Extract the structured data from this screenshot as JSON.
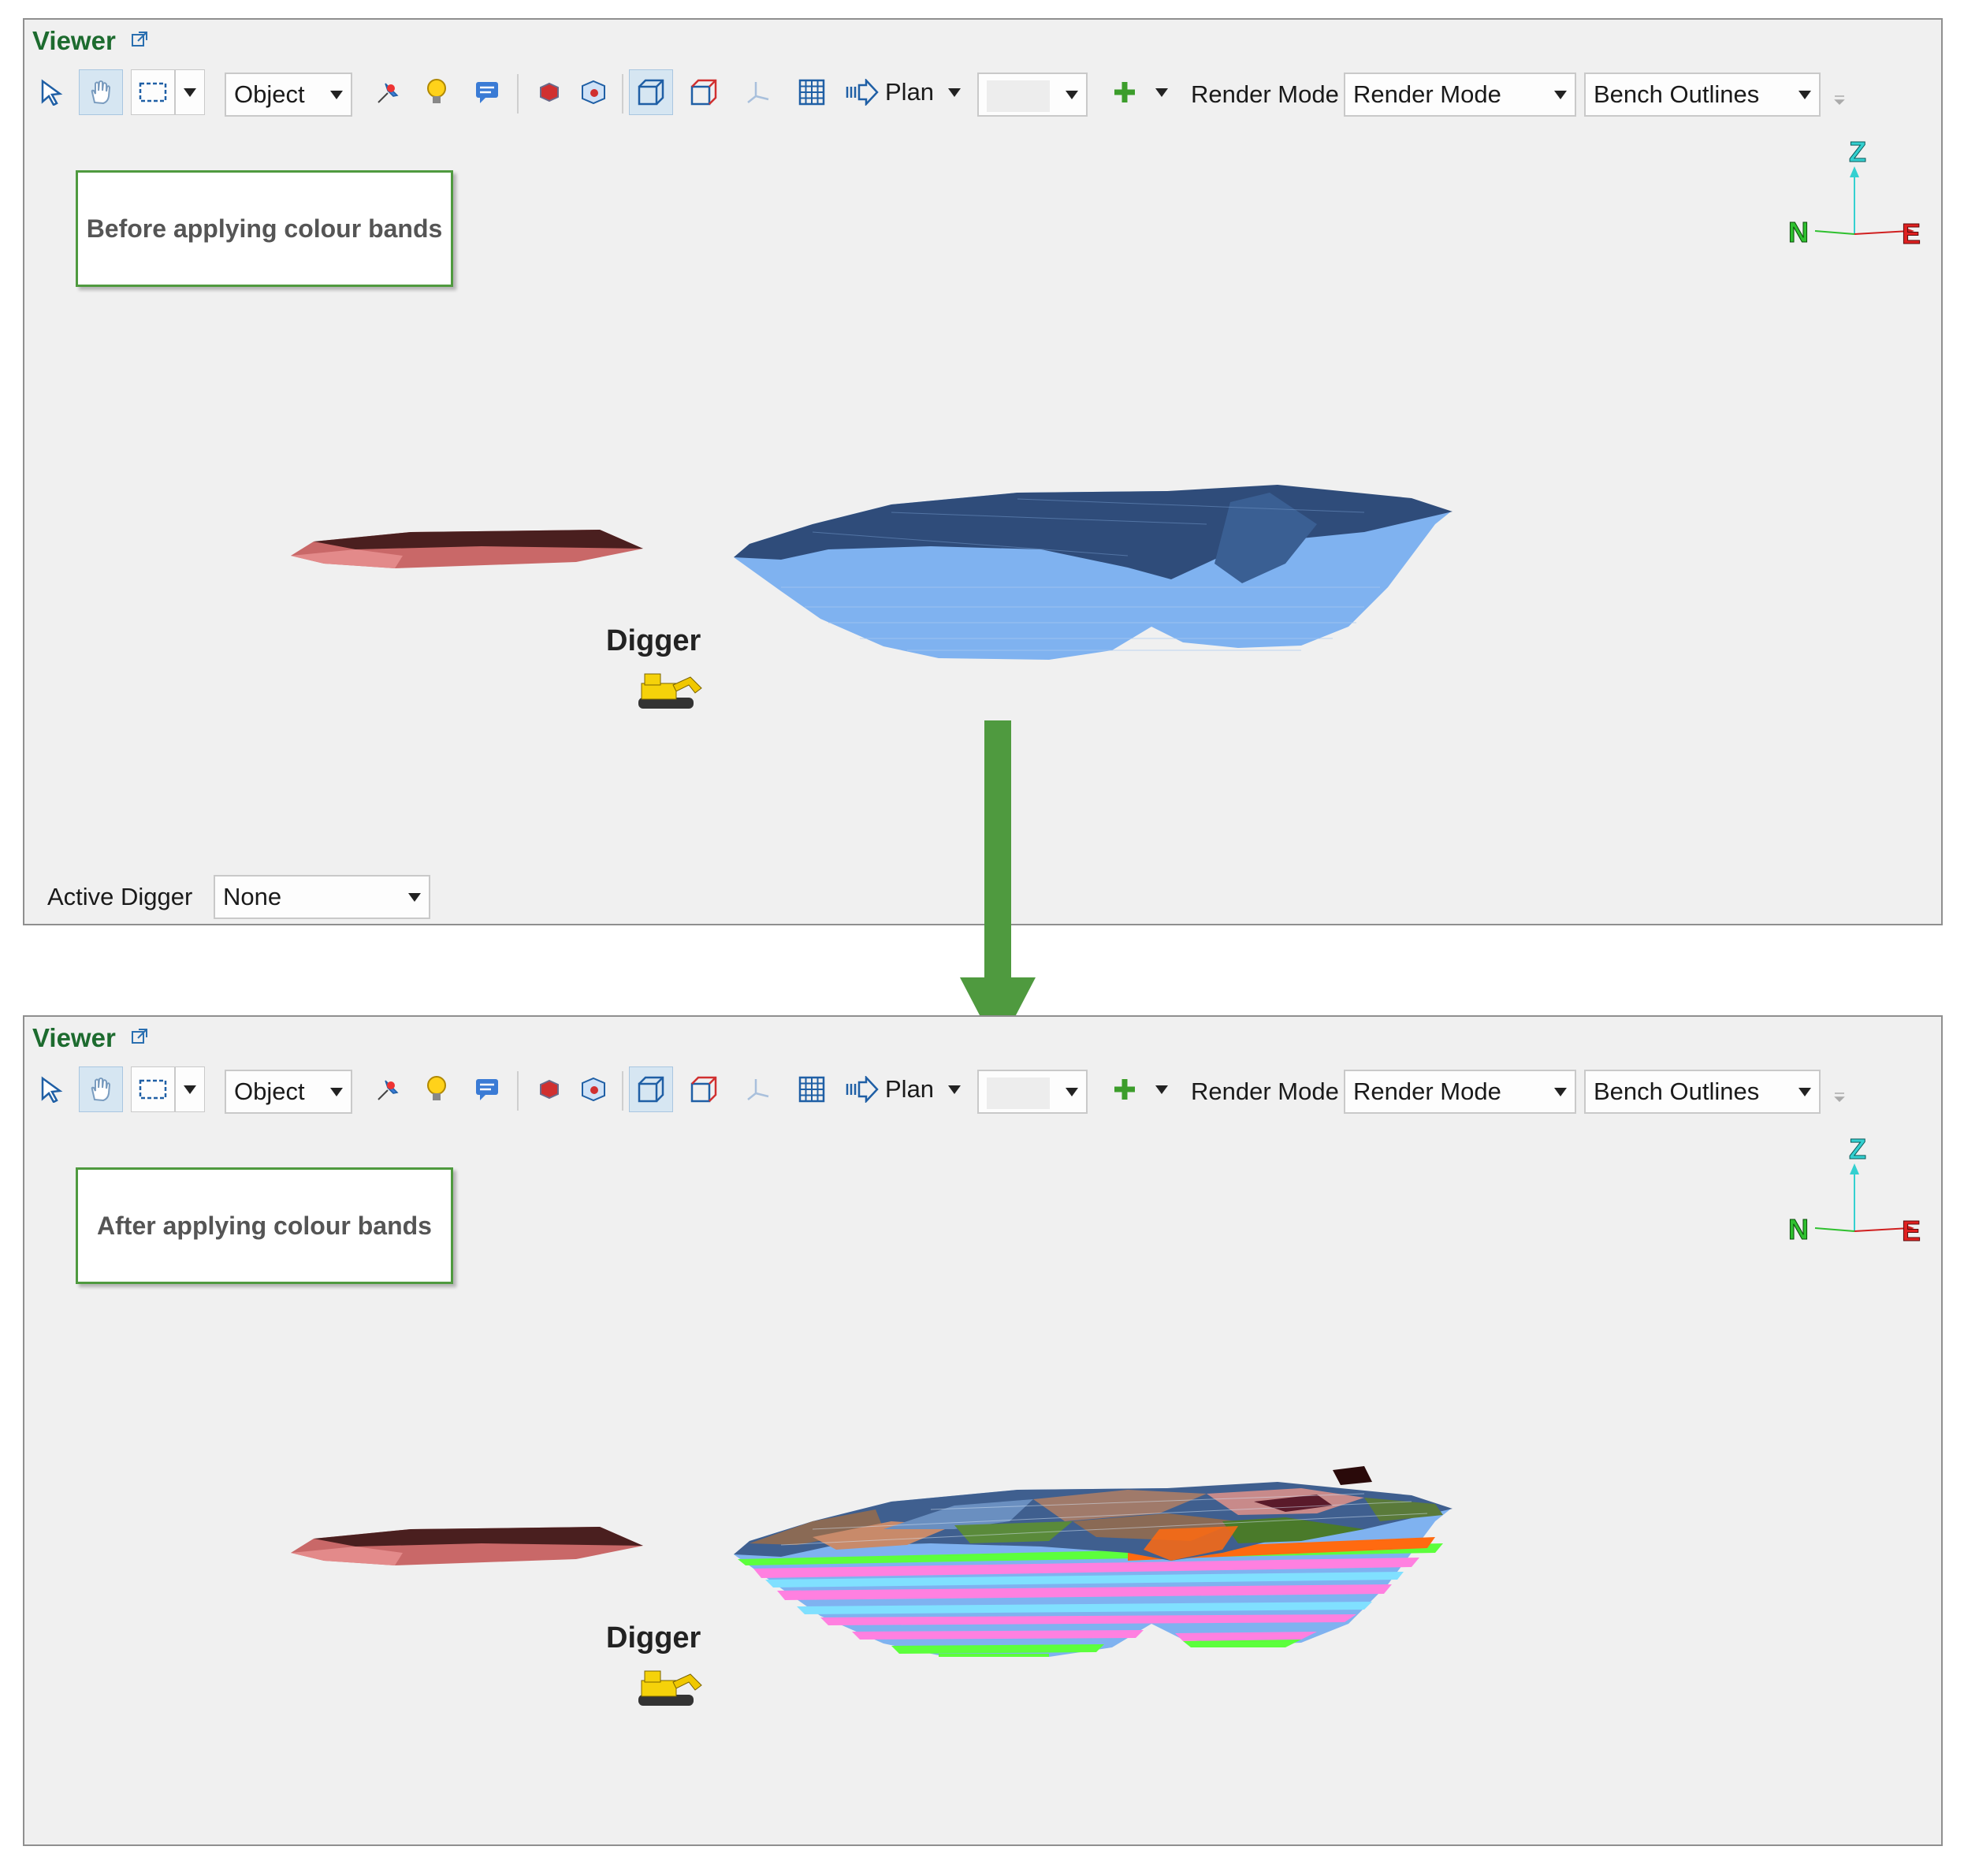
{
  "viewer_top": {
    "title": "Viewer",
    "toolbar": {
      "object_combo": "Object",
      "view_label": "Plan",
      "render_mode_label": "Render Mode",
      "render_mode_combo": "Render Mode",
      "outline_combo": "Bench Outlines"
    },
    "note": "Before applying colour bands",
    "digger_label": "Digger",
    "active_digger": {
      "label": "Active Digger",
      "value": "None"
    },
    "axes": {
      "z": "Z",
      "n": "N",
      "e": "E"
    }
  },
  "viewer_bottom": {
    "title": "Viewer",
    "toolbar": {
      "object_combo": "Object",
      "view_label": "Plan",
      "render_mode_label": "Render Mode",
      "render_mode_combo": "Render Mode",
      "outline_combo": "Bench Outlines"
    },
    "note": "After applying colour bands",
    "digger_label": "Digger",
    "axes": {
      "z": "Z",
      "n": "N",
      "e": "E"
    }
  },
  "icons": [
    "select-arrow-icon",
    "pan-hand-icon",
    "rectangle-select-icon",
    "pin-icon",
    "light-bulb-icon",
    "comment-icon",
    "red-cube-icon",
    "cube-face-icon",
    "wireframe-box-icon",
    "red-box-icon",
    "axis-icon",
    "grid-icon",
    "plan-arrow-icon",
    "plus-icon",
    "external-link-icon",
    "excavator-icon",
    "down-arrow-icon"
  ],
  "colors": {
    "title_green": "#1d6b2f",
    "note_border": "#4f9a3f",
    "arrow_green": "#4f9a3f",
    "pit_blue": "#7fb2f0",
    "pit_top": "#2e4a78",
    "band_magenta": "#ff80e0",
    "band_green": "#5cff3c",
    "band_orange": "#ff6a10",
    "band_cyan": "#80e0ff"
  }
}
